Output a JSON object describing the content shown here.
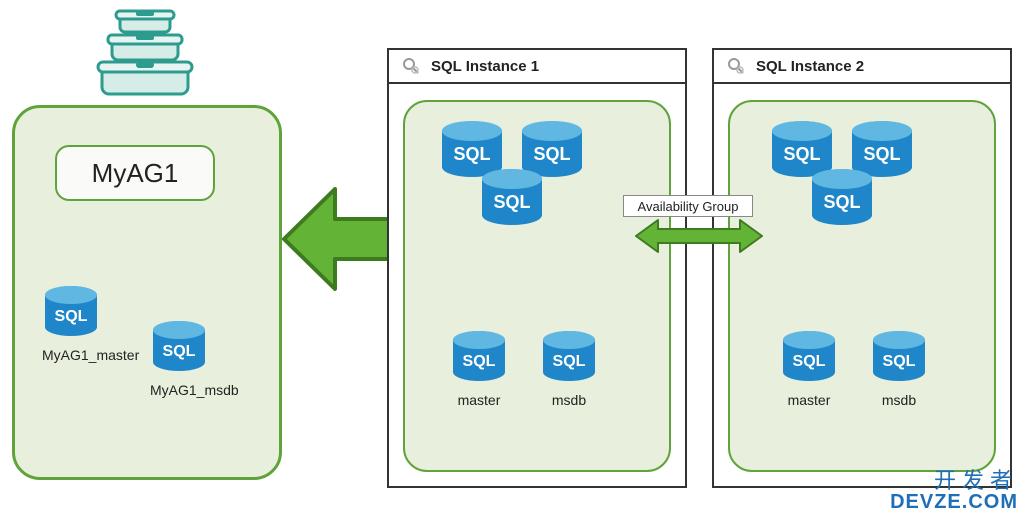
{
  "diagram": {
    "ag_box_title": "MyAG1",
    "ag_db_master": "MyAG1_master",
    "ag_db_msdb": "MyAG1_msdb",
    "instance1_title": "SQL Instance 1",
    "instance2_title": "SQL Instance 2",
    "db_label_sql": "SQL",
    "db_master": "master",
    "db_msdb": "msdb",
    "availability_group_label": "Availability Group",
    "colors": {
      "green_border": "#5fa33a",
      "green_fill": "#e8f0dd",
      "arrow_fill": "#62b336",
      "arrow_stroke": "#3e7a1f",
      "sql_blue": "#1f87c9",
      "sql_blue_light": "#5fb7e2",
      "container_teal": "#2e9b8f"
    }
  },
  "watermark": {
    "cn": "开发者",
    "en": "DEVZE.COM"
  }
}
